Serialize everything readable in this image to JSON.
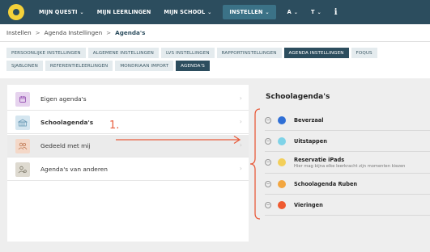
{
  "topnav": {
    "items": [
      {
        "label": "MIJN QUESTI",
        "chevron": true
      },
      {
        "label": "MIJN LEERLINGEN",
        "chevron": false
      },
      {
        "label": "MIJN SCHOOL",
        "chevron": true
      },
      {
        "label": "INSTELLEN",
        "chevron": true
      },
      {
        "label": "A",
        "chevron": true
      },
      {
        "label": "T",
        "chevron": true
      }
    ],
    "chevron_glyph": "⌄",
    "info_glyph": "i",
    "brand_color": "#2c4d5e",
    "active_color": "#3b7287",
    "logo_color": "#f4d13a"
  },
  "breadcrumb": {
    "items": [
      "Instellen",
      "Agenda Instellingen"
    ],
    "current": "Agenda's",
    "separator": ">"
  },
  "tabs": {
    "row1": [
      "PERSOONLIJKE INSTELLINGEN",
      "ALGEMENE INSTELLINGEN",
      "LVS INSTELLINGEN",
      "RAPPORTINSTELLINGEN",
      "AGENDA INSTELLINGEN",
      "FOQUS"
    ],
    "row2": [
      "SJABLONEN",
      "REFERENTIELEERLINGEN",
      "MONDRIAAN IMPORT",
      "AGENDA'S"
    ],
    "active_row1": "AGENDA INSTELLINGEN",
    "active_row2": "AGENDA'S"
  },
  "left_list": {
    "items": [
      {
        "label": "Eigen agenda's",
        "icon": "calendar-icon",
        "icon_bg": "#e6d3ee",
        "icon_color": "#9b59b6"
      },
      {
        "label": "Schoolagenda's",
        "icon": "school-icon",
        "icon_bg": "#d5e6f0",
        "icon_color": "#6a9ab5",
        "selected": true
      },
      {
        "label": "Gedeeld met mij",
        "icon": "shared-users-icon",
        "icon_bg": "#f4d8c8",
        "icon_color": "#c07a55"
      },
      {
        "label": "Agenda's van anderen",
        "icon": "user-settings-icon",
        "icon_bg": "#dedad0",
        "icon_color": "#7a7565"
      }
    ],
    "chevron_glyph": "›"
  },
  "annotation": {
    "number": "1.",
    "color": "#e85c3c"
  },
  "right_panel": {
    "title": "Schoolagenda's",
    "minus_glyph": "−",
    "agendas": [
      {
        "name": "Beverzaal",
        "color": "#2f6fd6"
      },
      {
        "name": "Uitstappen",
        "color": "#7fd3e8"
      },
      {
        "name": "Reservatie iPads",
        "subtitle": "Hier mag bijna elke leerkracht zijn momenten kiezen",
        "color": "#f3cf5a"
      },
      {
        "name": "Schoolagenda Ruben",
        "color": "#f2a640"
      },
      {
        "name": "Vieringen",
        "color": "#ef5a30"
      }
    ]
  }
}
